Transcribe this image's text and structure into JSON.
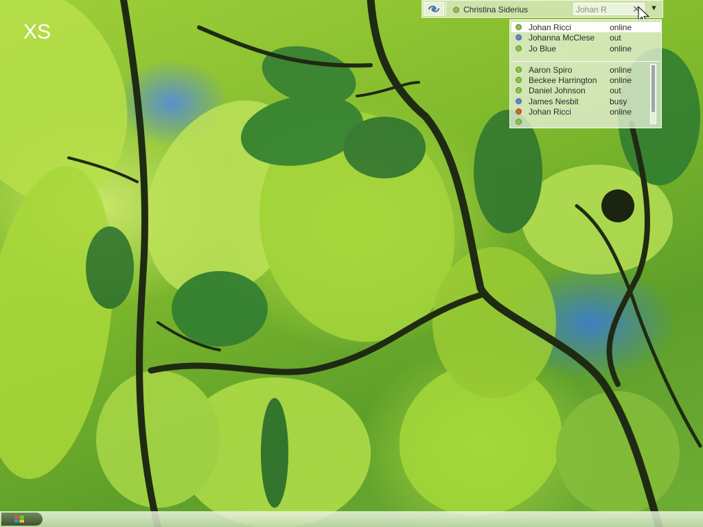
{
  "desktop": {
    "label": "XS"
  },
  "topbar": {
    "logo_icon": "swirl-logo-icon",
    "user": {
      "name": "Christina Siderius",
      "status_color": "#8bc34a"
    },
    "search": {
      "value": "Johan R"
    },
    "clear_icon": "close-icon",
    "dropdown_icon": "triangle-down-icon"
  },
  "contacts_top": [
    {
      "name": "Johan Ricci",
      "status": "online",
      "color": "#8bc34a",
      "selected": true
    },
    {
      "name": "Johanna McClese",
      "status": "out",
      "color": "#6d7fd6"
    },
    {
      "name": "Jo Blue",
      "status": "online",
      "color": "#8bc34a"
    }
  ],
  "contacts_list": [
    {
      "name": "Aaron Spiro",
      "status": "online",
      "color": "#8bc34a"
    },
    {
      "name": "Beckee Harrington",
      "status": "online",
      "color": "#8bc34a"
    },
    {
      "name": "Daniel Johnson",
      "status": "out",
      "color": "#8bc34a"
    },
    {
      "name": "James Nesbit",
      "status": "busy",
      "color": "#6d7fd6"
    },
    {
      "name": "Johan Ricci",
      "status": "online",
      "color": "#d0642b"
    },
    {
      "name": "",
      "status": "",
      "color": "#8bc34a"
    }
  ],
  "taskbar": {
    "start_icon": "windows-logo-icon"
  }
}
